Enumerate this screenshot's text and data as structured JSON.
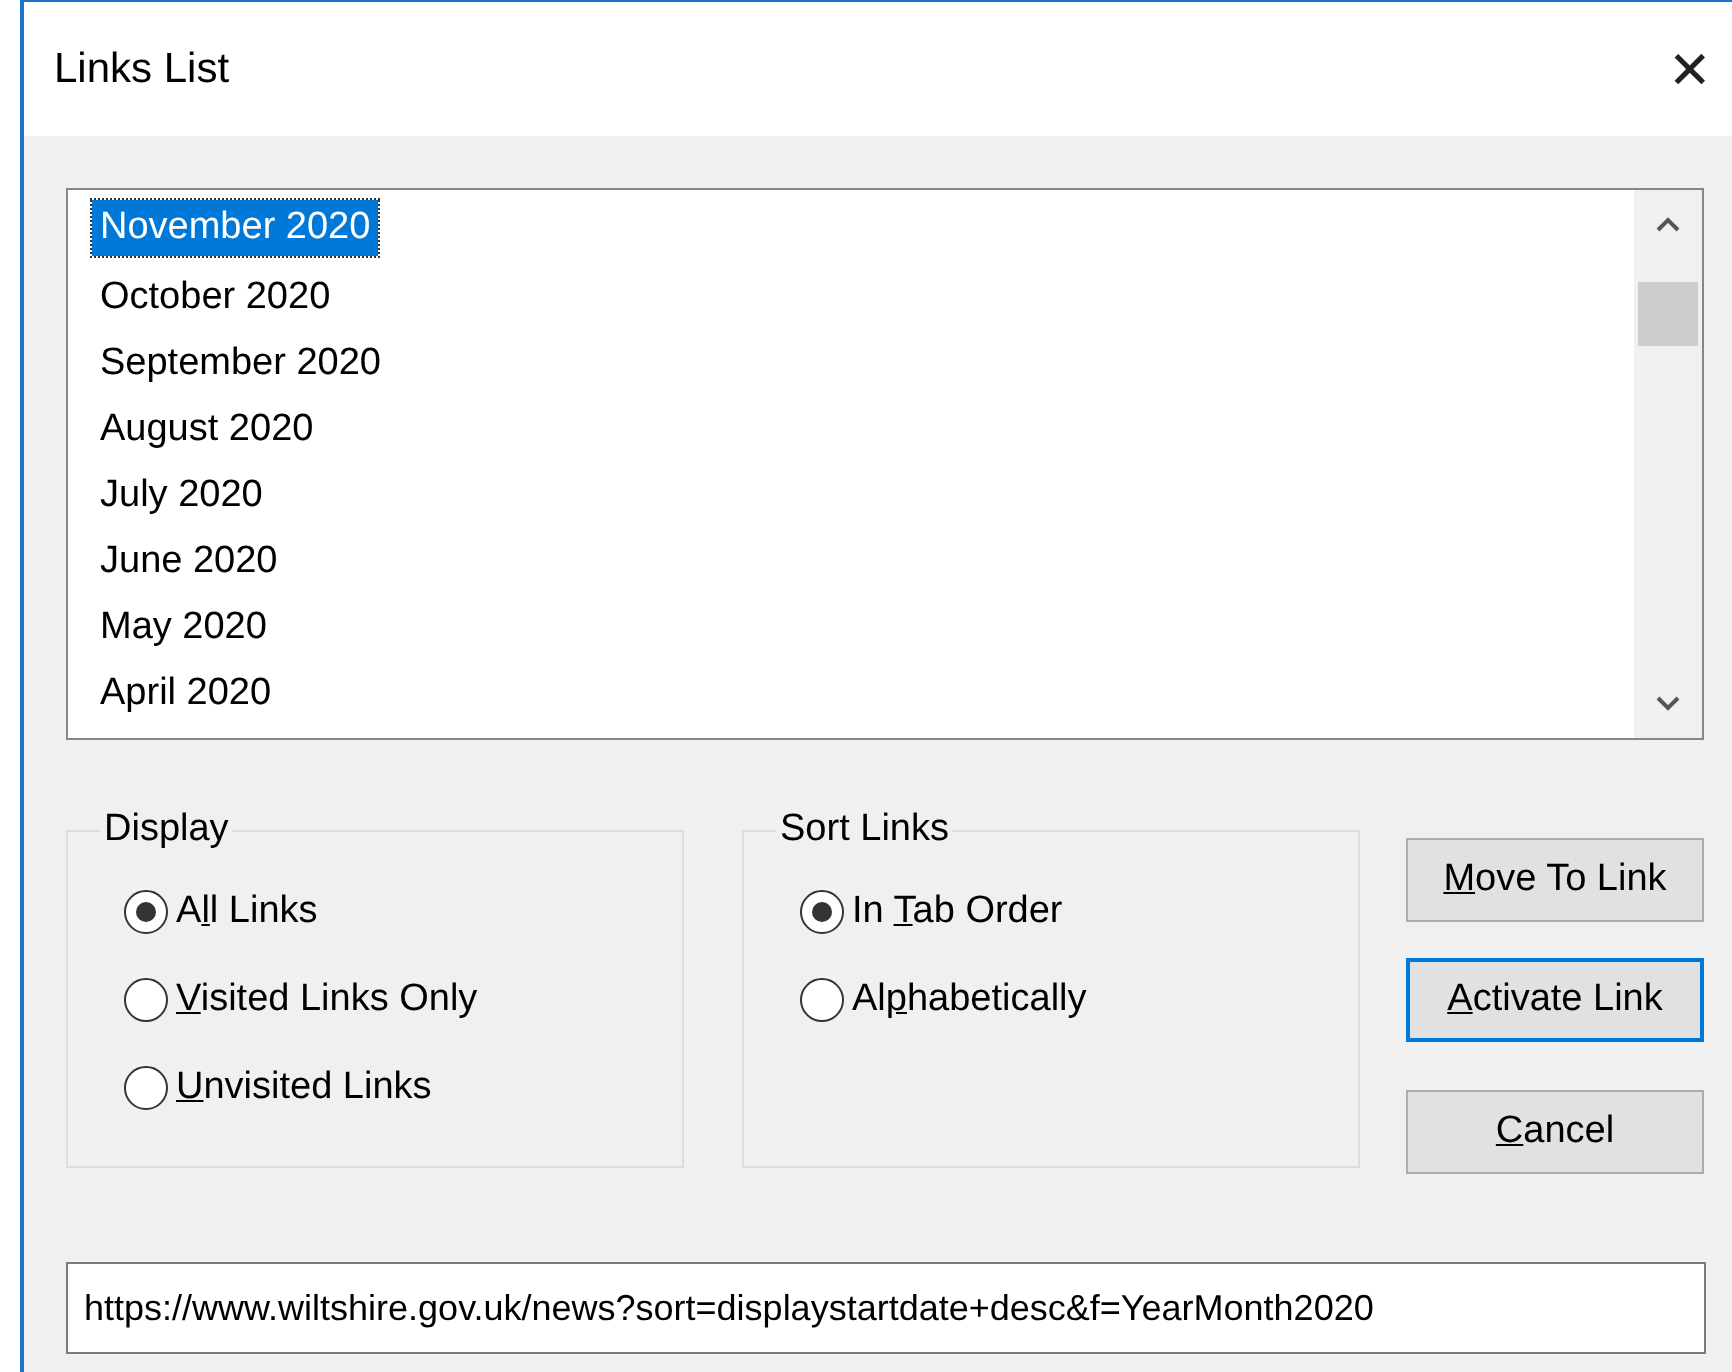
{
  "window": {
    "title": "Links List",
    "close": "✕"
  },
  "links_list": {
    "items": [
      {
        "label": "November 2020",
        "selected": true
      },
      {
        "label": "October 2020",
        "selected": false
      },
      {
        "label": "September 2020",
        "selected": false
      },
      {
        "label": "August 2020",
        "selected": false
      },
      {
        "label": "July 2020",
        "selected": false
      },
      {
        "label": "June 2020",
        "selected": false
      },
      {
        "label": "May 2020",
        "selected": false
      },
      {
        "label": "April 2020",
        "selected": false
      }
    ]
  },
  "display": {
    "title": "Display",
    "options": [
      {
        "prefix": "A",
        "key": "l",
        "rest": "l Links",
        "selected": true
      },
      {
        "key": "V",
        "rest": "isited Links Only",
        "selected": false
      },
      {
        "key": "U",
        "rest": "nvisited Links",
        "selected": false
      }
    ]
  },
  "sort_links": {
    "title": "Sort Links",
    "options": [
      {
        "prefix": "In ",
        "key": "T",
        "rest": "ab Order",
        "selected": true
      },
      {
        "prefix": "Al",
        "key": "p",
        "rest": "habetically",
        "selected": false
      }
    ]
  },
  "buttons": [
    {
      "key": "M",
      "rest": "ove To Link",
      "default": false
    },
    {
      "key": "A",
      "rest": "ctivate Link",
      "default": true
    },
    {
      "key": "C",
      "rest": "ancel",
      "default": false
    }
  ],
  "url": {
    "value": "https://www.wiltshire.gov.uk/news?sort=displaystartdate+desc&f=YearMonth2020"
  }
}
